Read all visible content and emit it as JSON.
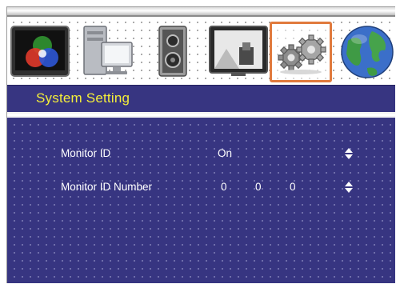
{
  "menu": {
    "icons": [
      {
        "name": "color-wheel-icon",
        "selected": false
      },
      {
        "name": "pc-computer-icon",
        "selected": false
      },
      {
        "name": "speaker-icon",
        "selected": false
      },
      {
        "name": "tv-display-icon",
        "selected": false
      },
      {
        "name": "gears-icon",
        "selected": true
      },
      {
        "name": "globe-icon",
        "selected": false
      }
    ]
  },
  "page": {
    "title": "System Setting"
  },
  "settings": [
    {
      "label": "Monitor ID",
      "value": "On",
      "control": "up-down-arrow-icon"
    },
    {
      "label": "Monitor ID Number",
      "digits": [
        "0",
        "0",
        "0"
      ],
      "control": "up-down-arrow-icon"
    }
  ],
  "colors": {
    "panel": "#373581",
    "title_text": "#f4ee3a",
    "selected_outline": "#e07a3d",
    "text": "#ffffff"
  }
}
